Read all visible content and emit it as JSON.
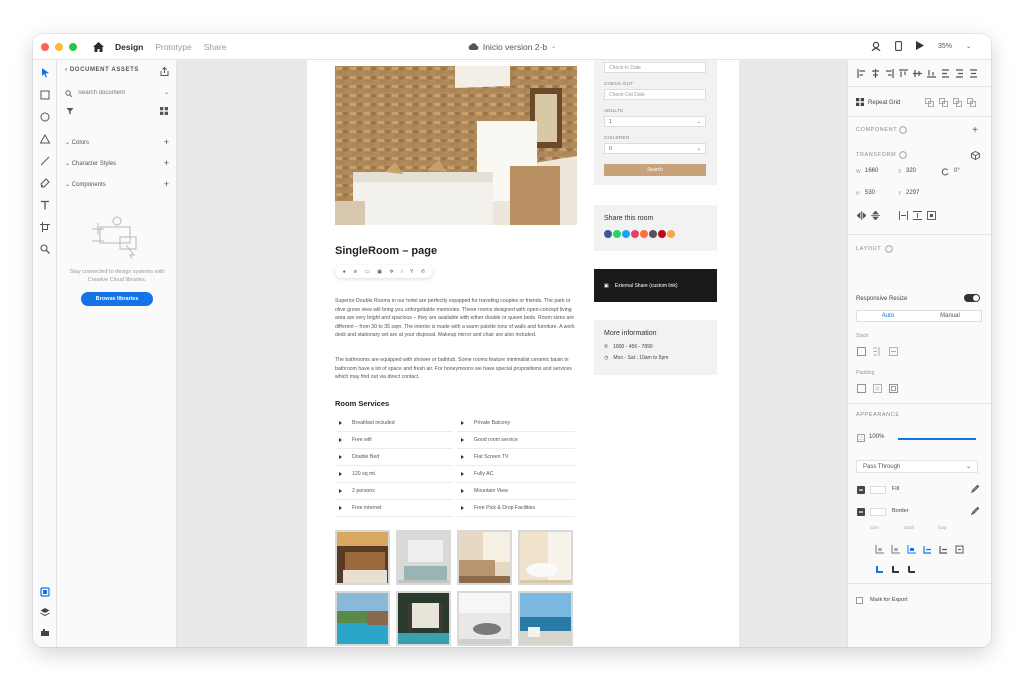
{
  "window": {
    "traffic_lights": [
      "#ff5f57",
      "#febc2e",
      "#28c840"
    ],
    "modes": [
      "Design",
      "Prototype",
      "Share"
    ],
    "active_mode": "Design",
    "doc_title": "Inicio version 2-b",
    "zoom": "35%"
  },
  "assets": {
    "title": "DOCUMENT ASSETS",
    "search_placeholder": "Search document",
    "sections": [
      "Colors",
      "Character Styles",
      "Components"
    ],
    "empty_message": "Stay connected to design systems with Creative Cloud libraries.",
    "browse_label": "Browse libraries"
  },
  "artboard": {
    "page_title": "SingleRoom – page",
    "paragraph1": "Superior Double Rooms in our hotel are perfectly equipped for traveling couples or friends. The park or olive grove view will bring you unforgettable memories. These rooms designed with open-concept living area are very bright and spacious – they are available with either double or queen beds. Room sizes are different – from 30 to 35 sqm. The interior is made with a warm palette tons of walls and furniture. A work desk and stationary set are at your disposal. Makeup mirror and chair are also included.",
    "paragraph2": "The bathrooms are equipped with shower or bathtub. Some rooms feature minimalist ceramic basin in bathroom have a lot of space and fresh air. For honeymoons we have special propositions and services which may find out via direct contact.",
    "services_title": "Room Services",
    "services_left": [
      "Breakfast included",
      "Free wifi",
      "Double Bed",
      "120 sq mt.",
      "2 persons",
      "Free internet"
    ],
    "services_right": [
      "Private Balcony",
      "Good room service",
      "Flat Screen TV",
      "Fully AC",
      "Mountain View",
      "Free Pick & Drop Facilities"
    ],
    "booking": {
      "checkin_placeholder": "Check-In Date",
      "checkout_label": "CHECK-OUT",
      "checkout_placeholder": "Check-Out Date",
      "adults_label": "ADULTS",
      "adults_value": "1",
      "children_label": "CHILDREN",
      "children_value": "0",
      "search_label": "Search"
    },
    "share_title": "Share this room",
    "social_colors": [
      "#3b5998",
      "#25d366",
      "#1da1f2",
      "#e4405f",
      "#ff6f3c",
      "#555555",
      "#bd081c",
      "#f4a742"
    ],
    "external_share": "External Share (custom link)",
    "more_title": "More information",
    "phone": "1800 - 456 - 7890",
    "hours": "Mon - Sat : 10am to 5pm"
  },
  "props": {
    "repeat_grid": "Repeat Grid",
    "component_label": "COMPONENT",
    "transform_label": "TRANSFORM",
    "w": "1660",
    "x": "320",
    "rotation": "0°",
    "h": "530",
    "y": "2297",
    "layout_label": "LAYOUT",
    "responsive_resize": "Responsive Resize",
    "auto": "Auto",
    "manual": "Manual",
    "stack_label": "Stack",
    "padding_label": "Padding",
    "appearance_label": "APPEARANCE",
    "opacity": "100%",
    "blend_mode": "Pass Through",
    "fill": "Fill",
    "border": "Border",
    "size_label": "Size",
    "dash_label": "Dash",
    "gap_label": "Gap",
    "mark_export": "Mark for Export"
  }
}
